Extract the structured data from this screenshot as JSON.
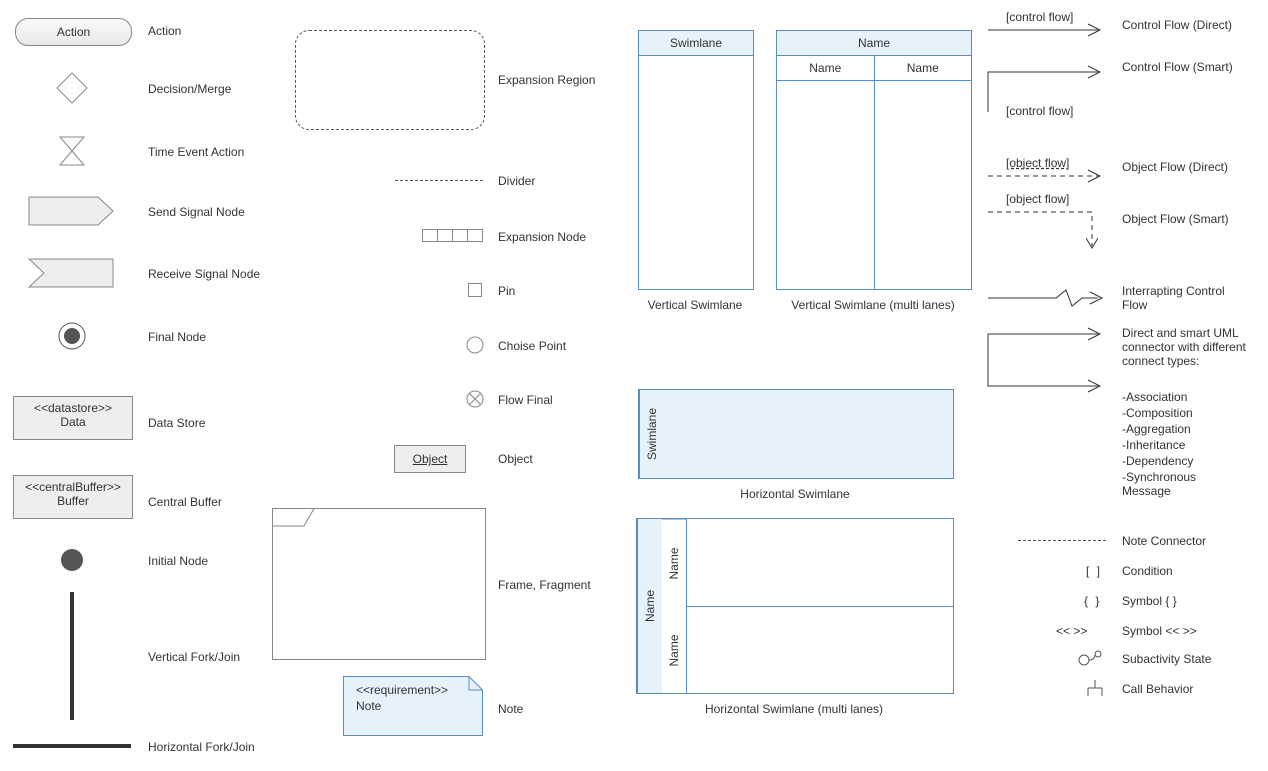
{
  "col1": {
    "action": {
      "shape_text": "Action",
      "label": "Action"
    },
    "decision": {
      "label": "Decision/Merge"
    },
    "time_event": {
      "label": "Time Event Action"
    },
    "send_signal": {
      "label": "Send Signal Node"
    },
    "receive_signal": {
      "label": "Receive Signal Node"
    },
    "final_node": {
      "label": "Final Node"
    },
    "datastore": {
      "stereo": "<<datastore>>",
      "name": "Data",
      "label": "Data Store"
    },
    "central_buffer": {
      "stereo": "<<centralBuffer>>",
      "name": "Buffer",
      "label": "Central Buffer"
    },
    "initial_node": {
      "label": "Initial Node"
    },
    "vfork": {
      "label": "Vertical Fork/Join"
    },
    "hfork": {
      "label": "Horizontal Fork/Join"
    }
  },
  "col2": {
    "expansion_region": {
      "label": "Expansion Region"
    },
    "divider": {
      "label": "Divider"
    },
    "expansion_node": {
      "label": "Expansion Node"
    },
    "pin": {
      "label": "Pin"
    },
    "choice_point": {
      "label": "Choise Point"
    },
    "flow_final": {
      "label": "Flow Final"
    },
    "object": {
      "shape_text": "Object",
      "label": "Object"
    },
    "frame": {
      "label": "Frame, Fragment"
    },
    "note": {
      "stereo": "<<requirement>>",
      "name": "Note",
      "label": "Note"
    }
  },
  "col3": {
    "v_swim": {
      "header": "Swimlane",
      "label": "Vertical Swimlane"
    },
    "v_swim_multi": {
      "header": "Name",
      "sub1": "Name",
      "sub2": "Name",
      "label": "Vertical Swimlane (multi lanes)"
    },
    "h_swim": {
      "header": "Swimlane",
      "label": "Horizontal Swimlane"
    },
    "h_swim_multi": {
      "header": "Name",
      "sub1": "Name",
      "sub2": "Name",
      "label": "Horizontal Swimlane (multi lanes)"
    }
  },
  "col4": {
    "cf_direct": {
      "tag": "[control flow]",
      "label": "Control Flow (Direct)"
    },
    "cf_smart": {
      "tag": "[control flow]",
      "label": "Control Flow (Smart)"
    },
    "of_direct": {
      "tag": "[object flow]",
      "label": "Object Flow (Direct)"
    },
    "of_smart": {
      "tag": "[object flow]",
      "label": "Object Flow (Smart)"
    },
    "interrupt": {
      "label": "Interrapting Control Flow"
    },
    "connectors": {
      "label": "Direct and smart UML connector with different connect types:",
      "items": [
        "-Association",
        "-Composition",
        "-Aggregation",
        "-Inheritance",
        "-Dependency",
        "-Synchronous Message"
      ]
    },
    "note_conn": {
      "label": "Note Connector"
    },
    "condition": {
      "symbol": "[ ]",
      "label": "Condition"
    },
    "braces": {
      "symbol": "{ }",
      "label": "Symbol { }"
    },
    "angles": {
      "symbol": "<< >>",
      "label": "Symbol << >>"
    },
    "subactivity": {
      "label": "Subactivity State"
    },
    "call_behavior": {
      "label": "Call Behavior"
    }
  }
}
